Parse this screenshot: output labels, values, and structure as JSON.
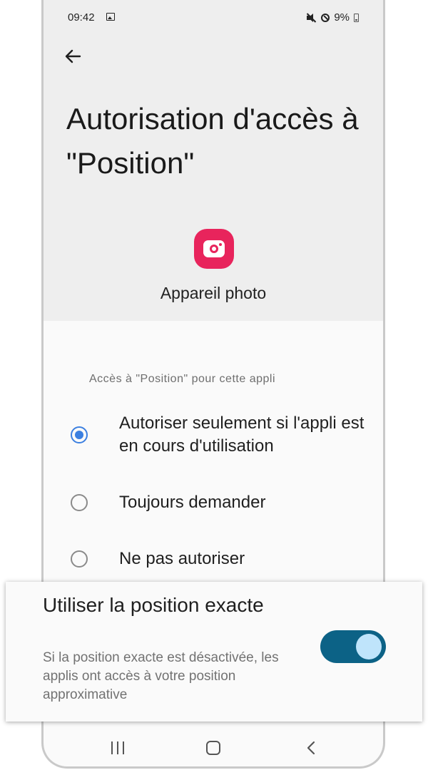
{
  "status_bar": {
    "time": "09:42",
    "battery_percent": "9%"
  },
  "header": {
    "title": "Autorisation d'accès à \"Position\""
  },
  "app": {
    "name": "Appareil photo",
    "icon": "camera-icon",
    "icon_color": "#e8245c"
  },
  "permissions": {
    "section_label": "Accès à \"Position\" pour cette appli",
    "options": [
      {
        "label": "Autoriser seulement si l'appli est en cours d'utilisation",
        "selected": true
      },
      {
        "label": "Toujours demander",
        "selected": false
      },
      {
        "label": "Ne pas autoriser",
        "selected": false
      }
    ]
  },
  "precise_location": {
    "title": "Utiliser la position exacte",
    "description": "Si la position exacte est désactivée, les applis ont accès à votre position approximative",
    "enabled": true,
    "toggle_color": "#0c6286"
  },
  "colors": {
    "accent": "#3b7fe0",
    "header_background": "#eeeeee"
  }
}
